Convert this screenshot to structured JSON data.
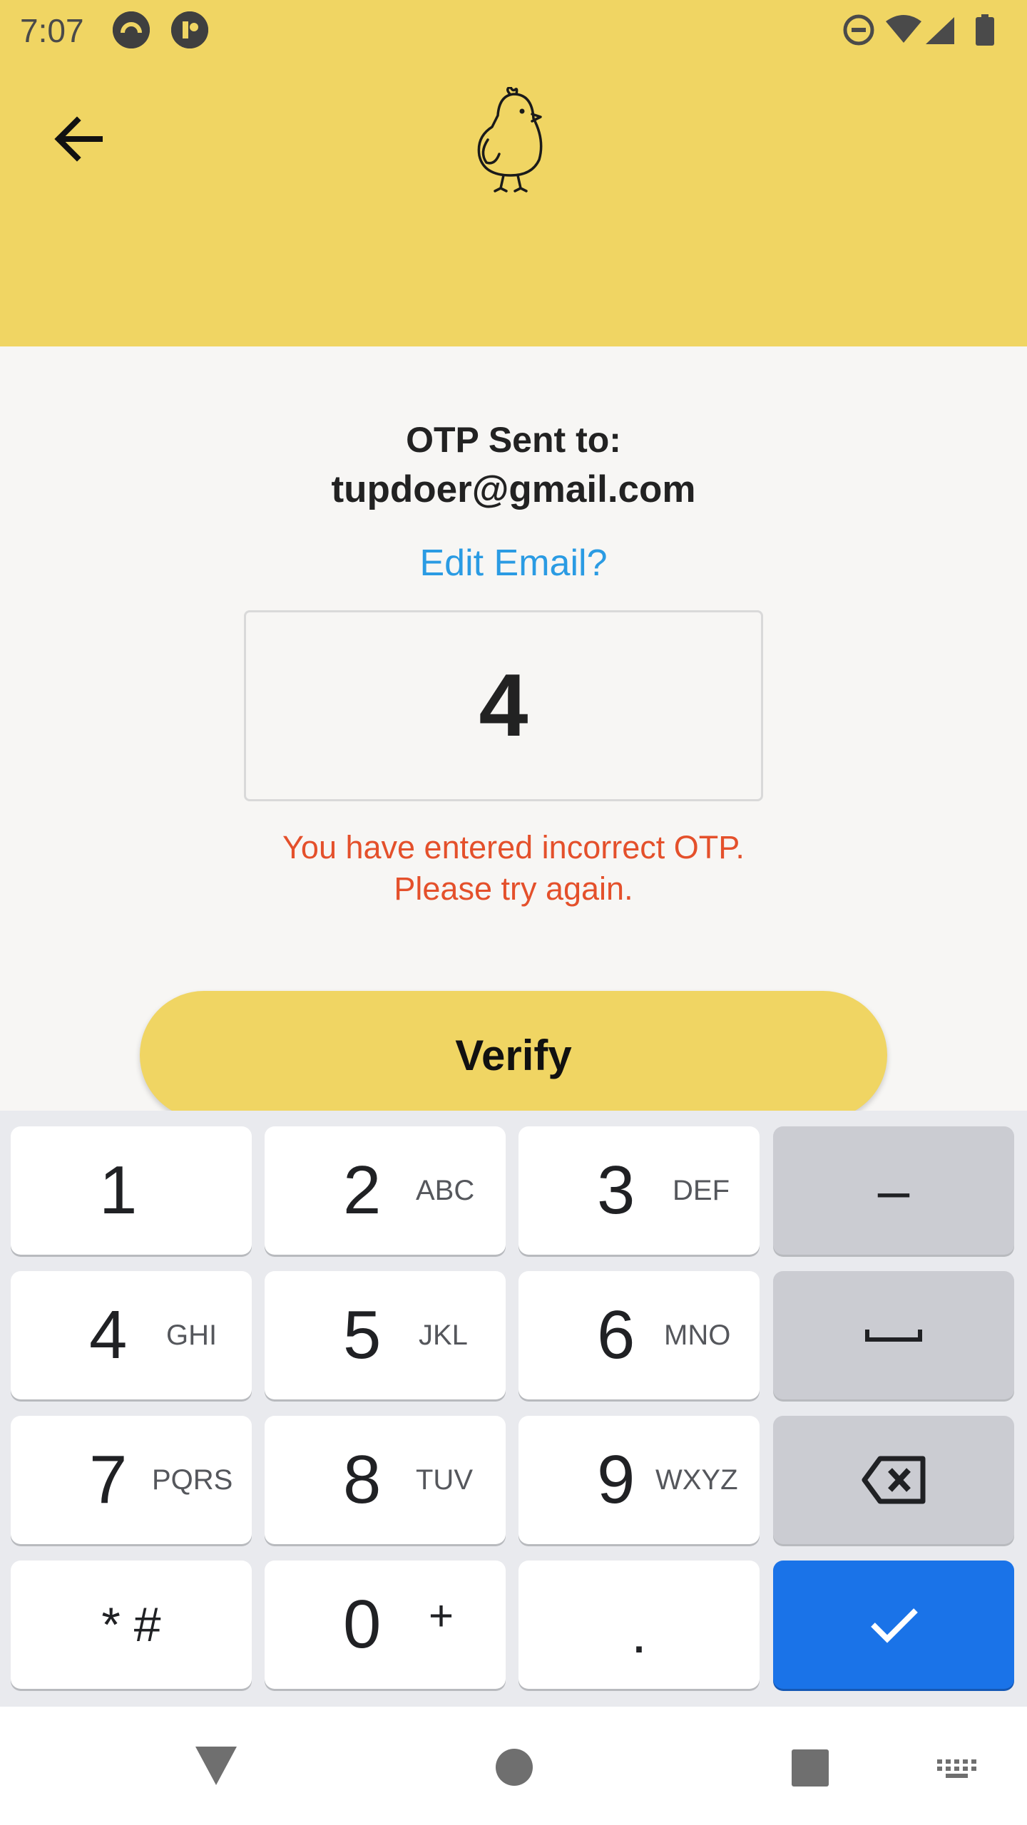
{
  "status_bar": {
    "time": "7:07"
  },
  "header": {
    "back_icon": "arrow-left-icon",
    "logo_icon": "chick-logo-icon",
    "background": "#f0d563"
  },
  "otp": {
    "sent_label": "OTP Sent to:",
    "email": "tupdoer@gmail.com",
    "edit_label": "Edit Email?",
    "input_value": "4",
    "error_line1": "You have entered incorrect OTP.",
    "error_line2": "Please try again.",
    "verify_label": "Verify"
  },
  "keyboard": {
    "keys": [
      {
        "num": "1",
        "letters": ""
      },
      {
        "num": "2",
        "letters": "ABC"
      },
      {
        "num": "3",
        "letters": "DEF"
      },
      {
        "label": "–"
      },
      {
        "num": "4",
        "letters": "GHI"
      },
      {
        "num": "5",
        "letters": "JKL"
      },
      {
        "num": "6",
        "letters": "MNO"
      },
      {
        "label": "space-icon"
      },
      {
        "num": "7",
        "letters": "PQRS"
      },
      {
        "num": "8",
        "letters": "TUV"
      },
      {
        "num": "9",
        "letters": "WXYZ"
      },
      {
        "label": "backspace-icon"
      },
      {
        "label": "* #"
      },
      {
        "num": "0",
        "letters": "+"
      },
      {
        "label": "."
      },
      {
        "label": "check-icon"
      }
    ]
  },
  "colors": {
    "accent_yellow": "#f0d563",
    "link_blue": "#2a9be3",
    "error_red": "#e4502b",
    "enter_blue": "#1a73e8"
  }
}
